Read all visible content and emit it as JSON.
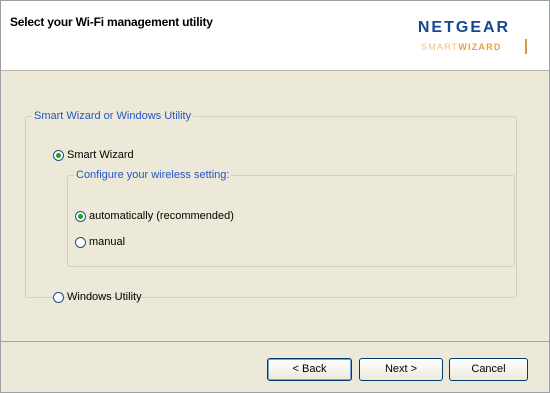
{
  "header": {
    "title": "Select your Wi-Fi management utility",
    "logo_name": "NETGEAR",
    "logo_sub_1": "SMART",
    "logo_sub_2": "WIZARD"
  },
  "group": {
    "legend": "Smart Wizard or Windows Utility",
    "smart_wizard_label": "Smart Wizard",
    "smart_wizard_checked": true,
    "windows_utility_label": "Windows Utility",
    "windows_utility_checked": false
  },
  "wireless": {
    "legend": "Configure your wireless setting:",
    "automatic_label": "automatically (recommended)",
    "automatic_checked": true,
    "manual_label": "manual",
    "manual_checked": false
  },
  "buttons": {
    "back": "< Back",
    "next": "Next >",
    "cancel": "Cancel"
  },
  "colors": {
    "legend": "#2455c3",
    "logo": "#16478f",
    "radio_dot": "#21a121",
    "window_bg": "#ece9d8"
  }
}
